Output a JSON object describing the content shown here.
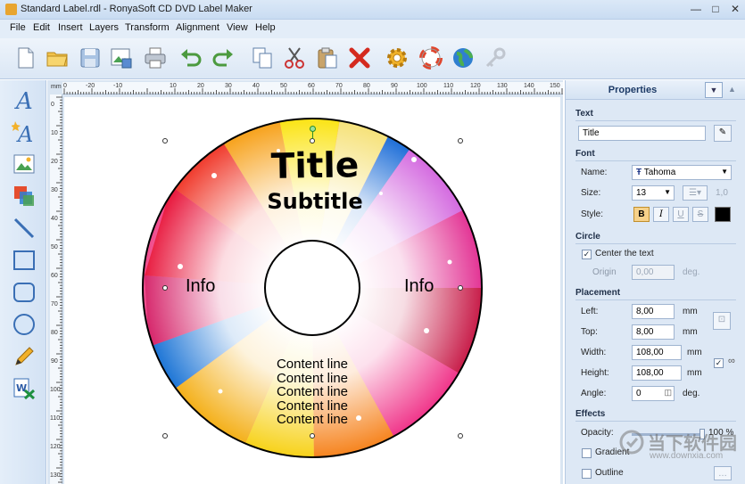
{
  "window": {
    "title": "Standard Label.rdl - RonyaSoft CD DVD Label Maker",
    "minimize": "—",
    "maximize": "□",
    "close": "✕"
  },
  "menu": [
    "File",
    "Edit",
    "Insert",
    "Layers",
    "Transform",
    "Alignment",
    "View",
    "Help"
  ],
  "toolbar": [
    "new-file",
    "open-folder",
    "save",
    "image-export",
    "print",
    "undo",
    "redo",
    "copy",
    "cut",
    "paste",
    "delete",
    "settings",
    "help",
    "web",
    "key"
  ],
  "left_tools": [
    "text",
    "curved-text",
    "image",
    "layers",
    "line",
    "rectangle",
    "rounded-rectangle",
    "circle",
    "pencil",
    "word-import"
  ],
  "ruler": {
    "unit": "mm",
    "h_ticks": [
      "0",
      "-20",
      "-10",
      "10",
      "20",
      "30",
      "40",
      "50",
      "60",
      "70",
      "80",
      "90",
      "100",
      "110",
      "120",
      "130",
      "140",
      "150"
    ],
    "v_ticks": [
      "0",
      "10",
      "20",
      "30",
      "40",
      "50",
      "60",
      "70",
      "80",
      "90",
      "100",
      "110",
      "120",
      "130"
    ]
  },
  "label": {
    "title": "Title",
    "subtitle": "Subtitle",
    "info_left": "Info",
    "info_right": "Info",
    "content_lines": [
      "Content line",
      "Content line",
      "Content line",
      "Content line",
      "Content line"
    ]
  },
  "properties": {
    "header": "Properties",
    "text_section": "Text",
    "text_value": "Title",
    "font_section": "Font",
    "name_label": "Name:",
    "name_value": "Tahoma",
    "size_label": "Size:",
    "size_value": "13",
    "spacing_value": "1,0",
    "style_label": "Style:",
    "style_buttons": [
      "B",
      "I",
      "U",
      "S"
    ],
    "circle_section": "Circle",
    "center_text": "Center the text",
    "origin_label": "Origin",
    "origin_value": "0,00",
    "origin_unit": "deg.",
    "placement_section": "Placement",
    "left_label": "Left:",
    "left_value": "8,00",
    "left_unit": "mm",
    "top_label": "Top:",
    "top_value": "8,00",
    "top_unit": "mm",
    "width_label": "Width:",
    "width_value": "108,00",
    "width_unit": "mm",
    "height_label": "Height:",
    "height_value": "108,00",
    "height_unit": "mm",
    "angle_label": "Angle:",
    "angle_value": "0",
    "angle_unit": "deg.",
    "effects_section": "Effects",
    "opacity_label": "Opacity:",
    "opacity_value": "100 %",
    "gradient_label": "Gradient",
    "outline_label": "Outline"
  },
  "watermark": {
    "cn": "当下软件园",
    "url": "www.downxia.com"
  },
  "colors": {
    "accent": "#1c3a66",
    "panel": "#dde8f5",
    "toolbar": "#dbe7f5"
  }
}
